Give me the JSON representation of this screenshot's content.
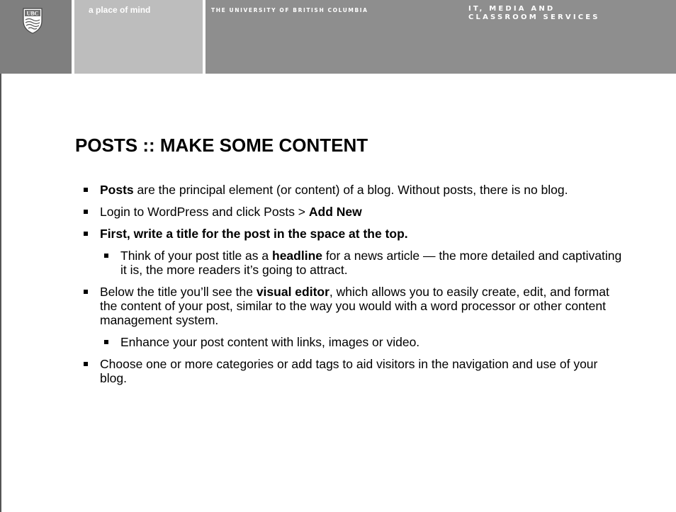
{
  "header": {
    "logo_text": "UBC",
    "tagline": "a place of mind",
    "university": "THE UNIVERSITY OF BRITISH COLUMBIA",
    "unit_line1": "IT, MEDIA AND",
    "unit_line2": "CLASSROOM SERVICES"
  },
  "slide": {
    "title": "POSTS :: MAKE SOME CONTENT",
    "bullets": [
      {
        "level": 1,
        "bold_lead": "Posts",
        "text": " are the principal element (or content) of a blog.  Without posts, there is no blog."
      },
      {
        "level": 1,
        "text": "Login to WordPress and click Posts > ",
        "bold_tail": "Add New"
      },
      {
        "level": 1,
        "text": "First, write a title for the post in the space at the top."
      },
      {
        "level": 2,
        "text_before": "Think of your post title as a ",
        "bold_mid": "headline",
        "text_after": " for a news article — the more detailed and captivating it is, the more readers it’s going to attract."
      },
      {
        "level": 1,
        "text_before": "Below the title you’ll see the ",
        "bold_mid": "visual editor",
        "text_after": ", which allows you to easily create, edit, and format the content of your post, similar to the way you would with a word processor or other content management system."
      },
      {
        "level": 2,
        "text": "Enhance your post content with links, images or video."
      },
      {
        "level": 1,
        "text": "Choose one or more categories or add tags to aid visitors in the navigation and use of your blog."
      }
    ]
  }
}
